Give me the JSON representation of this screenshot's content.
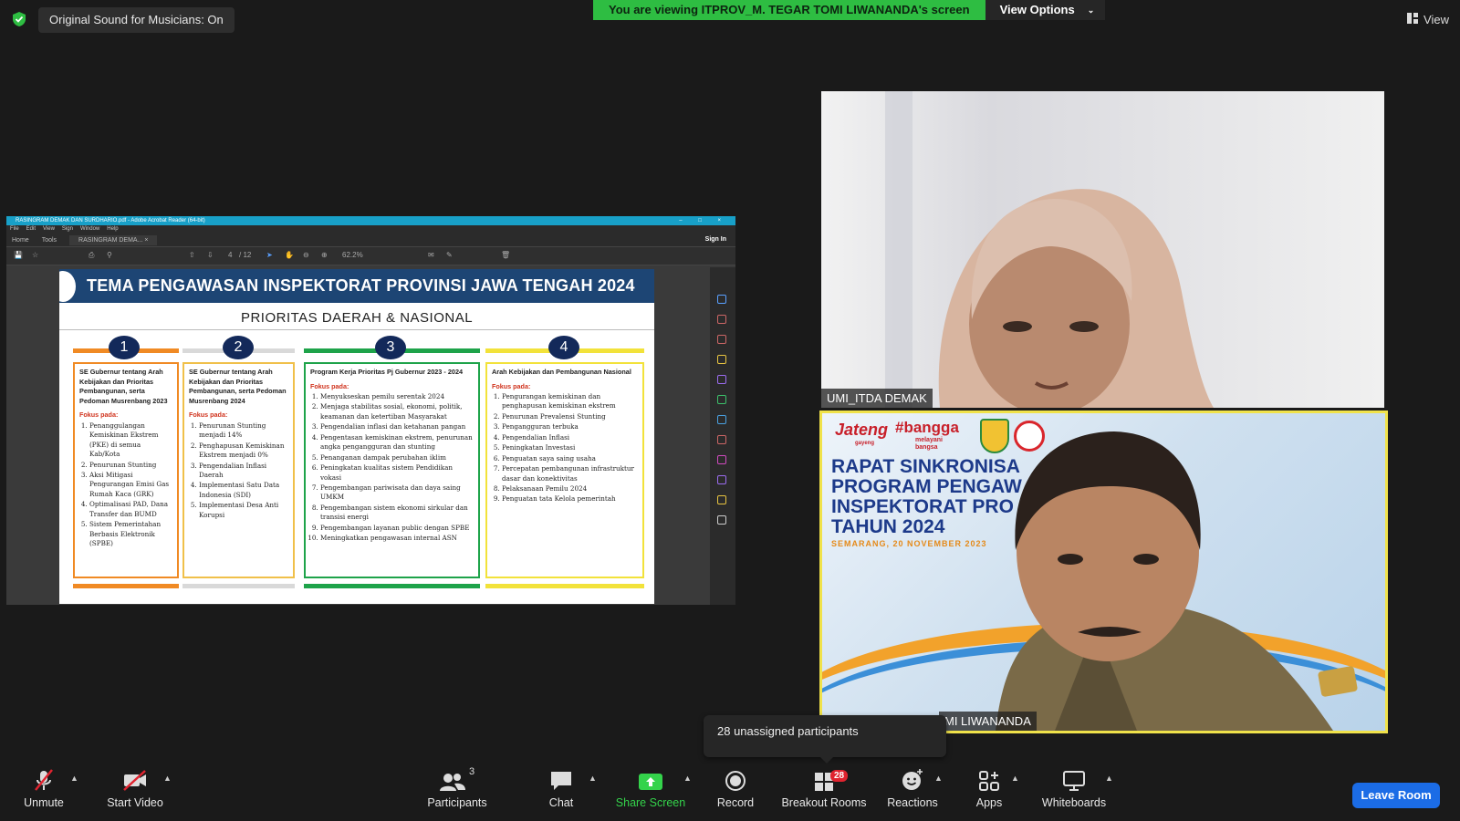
{
  "topbar": {
    "sound_label": "Original Sound for Musicians: On",
    "viewing_text": "You are viewing ITPROV_M. TEGAR TOMI LIWANANDA's screen",
    "view_options": "View Options",
    "view_label": "View"
  },
  "acrobat": {
    "title": "RASINGRAM DEMAK DAN SURDHARIO.pdf - Adobe Acrobat Reader (64-bit)",
    "menu": [
      "File",
      "Edit",
      "View",
      "Sign",
      "Window",
      "Help"
    ],
    "tab_home": "Home",
    "tab_tools": "Tools",
    "tab_doc": "RASINGRAM DEMA...",
    "sign_in": "Sign In",
    "page_current": "4",
    "page_total": "/ 12",
    "zoom": "62.2%"
  },
  "slide": {
    "banner": "TEMA PENGAWASAN INSPEKTORAT PROVINSI JAWA TENGAH 2024",
    "subtitle": "PRIORITAS DAERAH & NASIONAL",
    "columns": [
      {
        "num": "1",
        "color": "#f08a24",
        "heading": "SE Gubernur tentang Arah Kebijakan dan Prioritas Pembangunan, serta Pedoman Musrenbang 2023",
        "fokus": "Fokus pada:",
        "items": [
          "Penanggulangan Kemiskinan Ekstrem (PKE) di semua Kab/Kota",
          "Penurunan Stunting",
          "Aksi Mitigasi Pengurangan Emisi Gas Rumah Kaca (GRK)",
          "Optimalisasi PAD, Dana Transfer dan BUMD",
          "Sistem Pemerintahan Berbasis Elektronik (SPBE)"
        ]
      },
      {
        "num": "2",
        "color": "#f0c04a",
        "heading": "SE Gubernur tentang Arah Kebijakan dan Prioritas Pembangunan, serta Pedoman Musrenbang 2024",
        "fokus": "Fokus pada:",
        "items": [
          "Penurunan Stunting menjadi 14%",
          "Penghapusan Kemiskinan Ekstrem menjadi 0%",
          "Pengendalian Inflasi Daerah",
          "Implementasi Satu Data Indonesia (SDI)",
          "Implementasi Desa Anti Korupsi"
        ]
      },
      {
        "num": "3",
        "color": "#1ea34a",
        "heading": "Program Kerja Prioritas Pj Gubernur 2023 - 2024",
        "fokus": "Fokus pada:",
        "items": [
          "Menyukseskan pemilu serentak 2024",
          "Menjaga stabilitas sosial, ekonomi, politik, keamanan dan ketertiban Masyarakat",
          "Pengendalian inflasi dan ketahanan pangan",
          "Pengentasan kemiskinan ekstrem, penurunan angka pengangguran dan stunting",
          "Penanganan dampak perubahan iklim",
          "Peningkatan kualitas sistem Pendidikan vokasi",
          "Pengembangan pariwisata dan daya saing UMKM",
          "Pengembangan sistem ekonomi sirkular dan transisi energi",
          "Pengembangan layanan public dengan SPBE",
          "Meningkatkan pengawasan internal ASN"
        ]
      },
      {
        "num": "4",
        "color": "#f2e23a",
        "heading": "Arah Kebijakan dan Pembangunan Nasional",
        "fokus": "Fokus pada:",
        "items": [
          "Pengurangan kemiskinan dan penghapusan kemiskinan ekstrem",
          "Penurunan Prevalensi Stunting",
          "Pengangguran terbuka",
          "Pengendalian Inflasi",
          "Peningkatan Investasi",
          "Penguatan saya saing usaha",
          "Percepatan pembangunan infrastruktur dasar dan konektivitas",
          "Pelaksanaan Pemilu 2024",
          "Penguatan tata Kelola pemerintah"
        ]
      }
    ]
  },
  "tiles": {
    "umi_name": "UMI_ITDA DEMAK",
    "tegar_name": "MI LIWANANDA",
    "ppt_logo_jateng": "Jateng",
    "ppt_logo_jateng_sub": "gayeng",
    "ppt_logo_bangga": "#bangga",
    "ppt_logo_bangga_sub": "melayani bangsa",
    "ppt_title": "RAPAT SINKRONISA\nPROGRAM PENGAW\nINSPEKTORAT PRO\nTAHUN 2024",
    "ppt_date": "SEMARANG, 20 NOVEMBER 2023"
  },
  "tooltip": "28 unassigned participants",
  "toolbar": {
    "unmute": "Unmute",
    "start_video": "Start Video",
    "participants": "Participants",
    "participants_count": "3",
    "chat": "Chat",
    "share_screen": "Share Screen",
    "record": "Record",
    "breakout_rooms": "Breakout Rooms",
    "breakout_badge": "28",
    "reactions": "Reactions",
    "apps": "Apps",
    "whiteboards": "Whiteboards",
    "leave": "Leave Room"
  },
  "colors": {
    "zoom_green": "#2ebd42",
    "leave_blue": "#1b6ce6",
    "active_speaker": "#f0e24a",
    "slide_banner": "#1d4574"
  }
}
